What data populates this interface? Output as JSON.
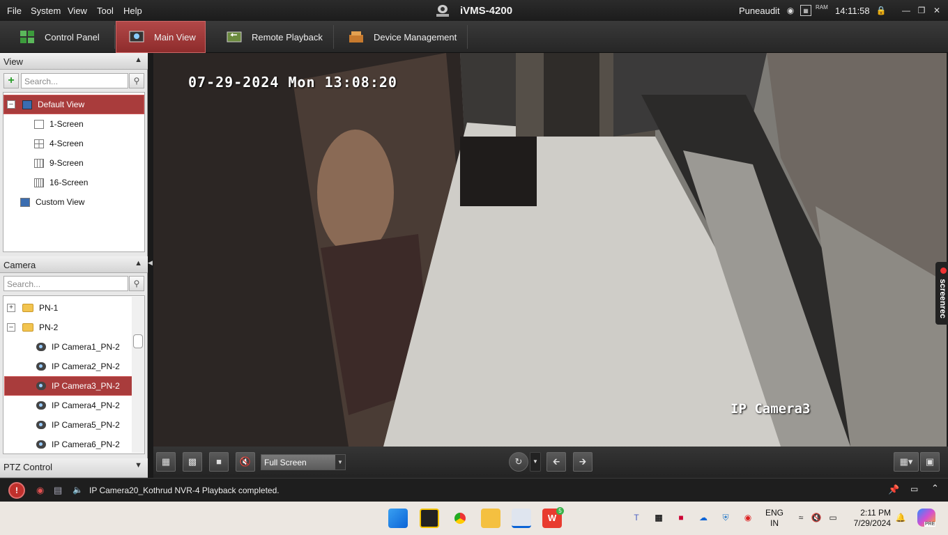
{
  "menubar": {
    "items": [
      "File",
      "System",
      "View",
      "Tool",
      "Help"
    ],
    "title": "iVMS-4200",
    "user": "Puneaudit",
    "time": "14:11:58"
  },
  "tabs": [
    {
      "label": "Control Panel"
    },
    {
      "label": "Main View"
    },
    {
      "label": "Remote Playback"
    },
    {
      "label": "Device Management"
    }
  ],
  "view_panel": {
    "title": "View",
    "search_placeholder": "Search...",
    "items": [
      {
        "label": "Default View"
      },
      {
        "label": "1-Screen"
      },
      {
        "label": "4-Screen"
      },
      {
        "label": "9-Screen"
      },
      {
        "label": "16-Screen"
      },
      {
        "label": "Custom View"
      }
    ]
  },
  "camera_panel": {
    "title": "Camera",
    "search_placeholder": "Search...",
    "items": [
      {
        "label": "PN-1"
      },
      {
        "label": "PN-2"
      },
      {
        "label": "IP Camera1_PN-2"
      },
      {
        "label": "IP Camera2_PN-2"
      },
      {
        "label": "IP Camera3_PN-2"
      },
      {
        "label": "IP Camera4_PN-2"
      },
      {
        "label": "IP Camera5_PN-2"
      },
      {
        "label": "IP Camera6_PN-2"
      }
    ]
  },
  "ptz_panel": {
    "title": "PTZ Control"
  },
  "video": {
    "timestamp": "07-29-2024 Mon 13:08:20",
    "camera_name": "IP Camera3",
    "overlay_badge": "screenrec"
  },
  "video_toolbar": {
    "mode_select": "Full Screen"
  },
  "status": {
    "message": "IP Camera20_Kothrud NVR-4 Playback completed."
  },
  "taskbar": {
    "lang_line1": "ENG",
    "lang_line2": "IN",
    "time": "2:11 PM",
    "date": "7/29/2024",
    "copilot_badge": "PRE",
    "wps_badge": "5"
  },
  "colors": {
    "accent": "#a93c3c",
    "tab_active": "#b24848",
    "panel_bg": "#e8e8e8"
  }
}
